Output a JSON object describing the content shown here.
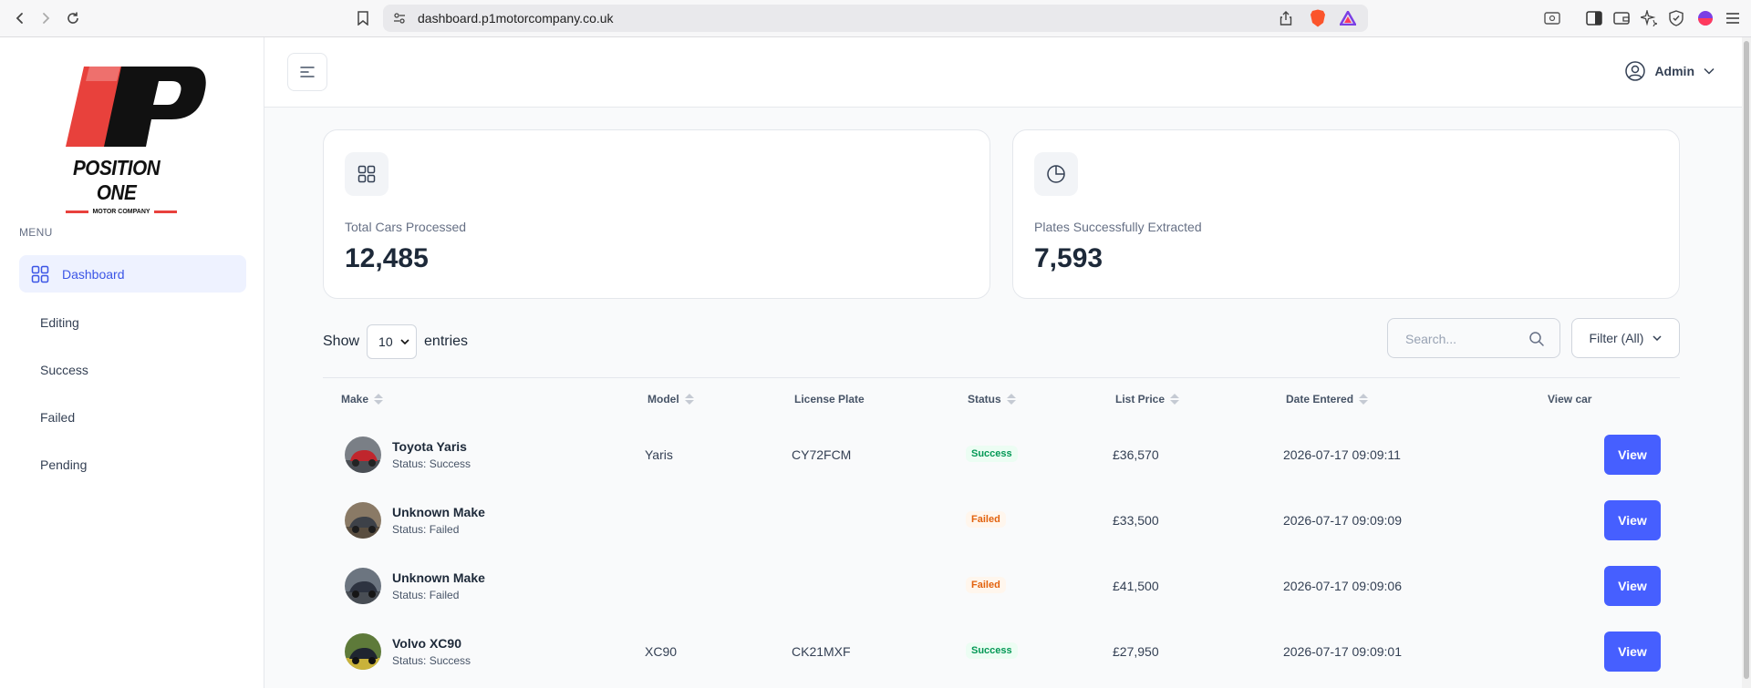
{
  "browser": {
    "url": "dashboard.p1motorcompany.co.uk"
  },
  "brand": {
    "name": "POSITION ONE",
    "subtitle": "MOTOR COMPANY",
    "accent_color": "#e8413c"
  },
  "sidebar": {
    "heading": "MENU",
    "items": [
      {
        "label": "Dashboard",
        "active": true
      },
      {
        "label": "Editing"
      },
      {
        "label": "Success"
      },
      {
        "label": "Failed"
      },
      {
        "label": "Pending"
      }
    ]
  },
  "header": {
    "user_label": "Admin"
  },
  "stats": [
    {
      "label": "Total Cars Processed",
      "value": "12,485",
      "icon": "grid-icon"
    },
    {
      "label": "Plates Successfully Extracted",
      "value": "7,593",
      "icon": "pie-chart-icon"
    }
  ],
  "table_controls": {
    "show_label": "Show",
    "entries_value": "10",
    "entries_label": "entries",
    "search_placeholder": "Search...",
    "filter_label": "Filter (All)"
  },
  "table": {
    "columns": [
      "Make",
      "Model",
      "License Plate",
      "Status",
      "List Price",
      "Date Entered",
      "View car"
    ],
    "rows": [
      {
        "make": "Toyota Yaris",
        "sub_status": "Status: Success",
        "model": "Yaris",
        "plate": "CY72FCM",
        "status": "Success",
        "price": "£36,570",
        "date": "2026-07-17 09:09:11",
        "action": "View"
      },
      {
        "make": "Unknown Make",
        "sub_status": "Status: Failed",
        "model": "",
        "plate": "",
        "status": "Failed",
        "price": "£33,500",
        "date": "2026-07-17 09:09:09",
        "action": "View"
      },
      {
        "make": "Unknown Make",
        "sub_status": "Status: Failed",
        "model": "",
        "plate": "",
        "status": "Failed",
        "price": "£41,500",
        "date": "2026-07-17 09:09:06",
        "action": "View"
      },
      {
        "make": "Volvo XC90",
        "sub_status": "Status: Success",
        "model": "XC90",
        "plate": "CK21MXF",
        "status": "Success",
        "price": "£27,950",
        "date": "2026-07-17 09:09:01",
        "action": "View"
      }
    ]
  },
  "colors": {
    "primary": "#465fff",
    "success": "#039855",
    "failed": "#e2620e"
  }
}
